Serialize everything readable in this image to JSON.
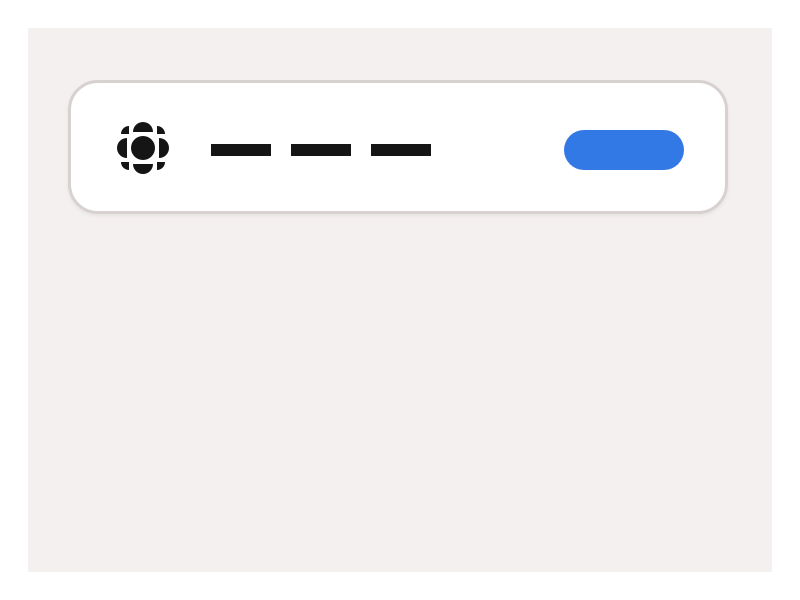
{
  "header": {
    "logo_icon": "cbc-gem-icon",
    "nav_items": [
      {
        "label": ""
      },
      {
        "label": ""
      },
      {
        "label": ""
      }
    ],
    "cta_label": ""
  },
  "colors": {
    "page_background": "#f5f0f0",
    "card_background": "#ffffff",
    "card_border": "#d7d2d0",
    "ink": "#151515",
    "accent": "#3279e6"
  }
}
